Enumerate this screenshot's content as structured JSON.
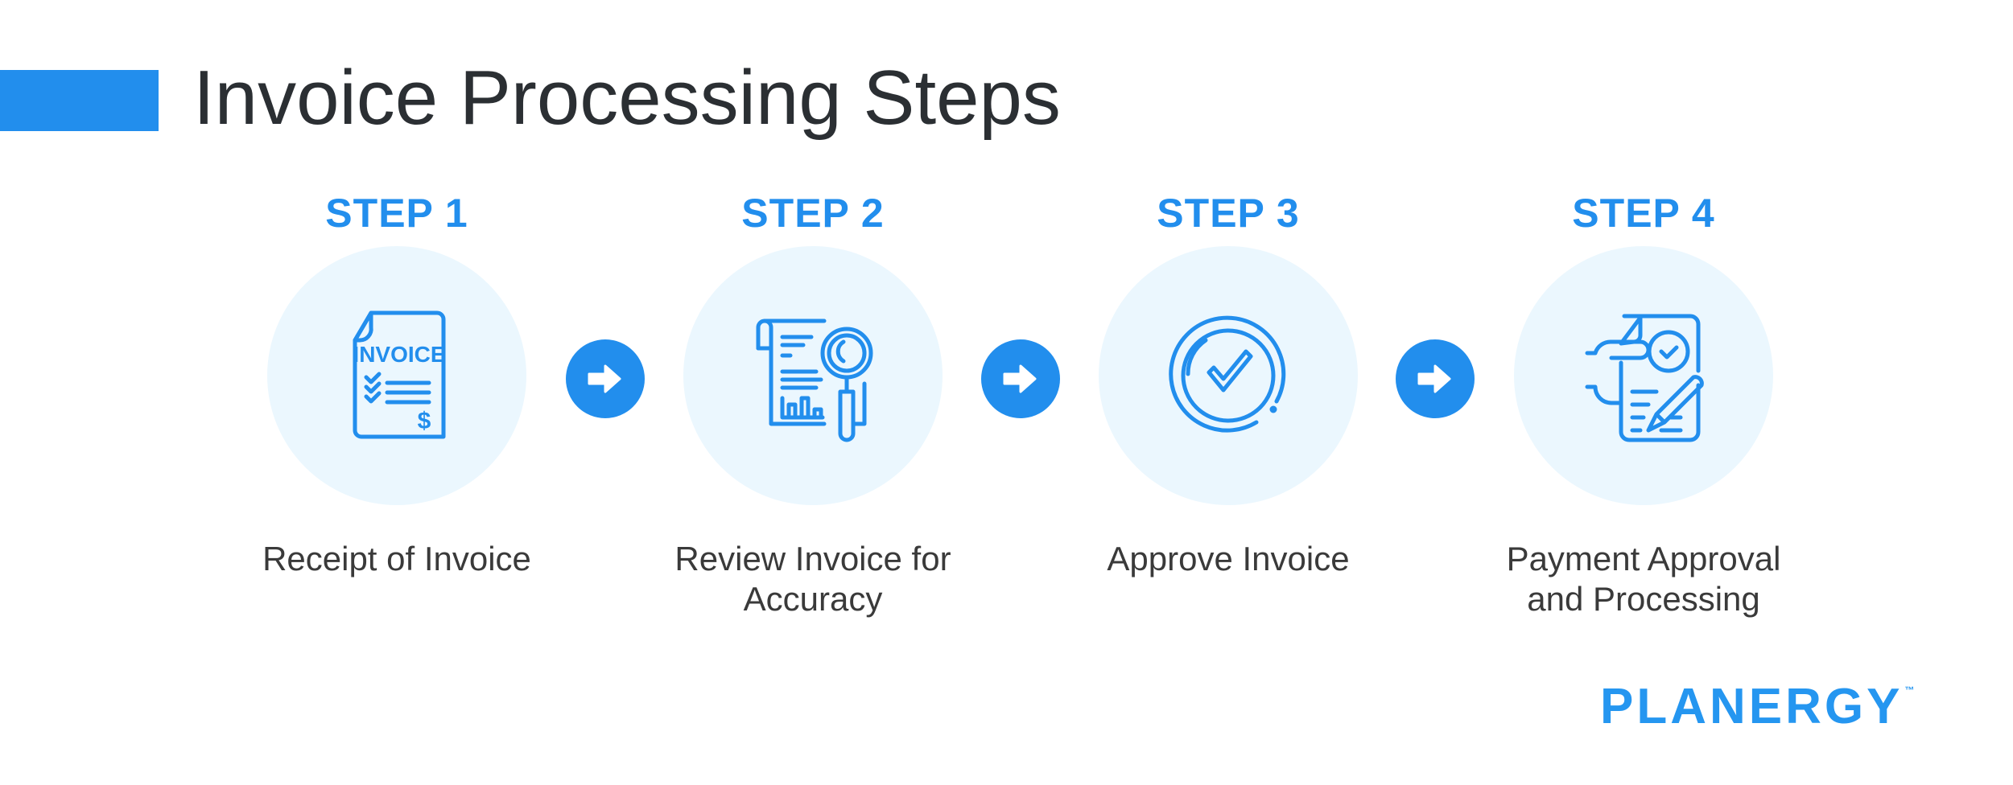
{
  "header": {
    "title": "Invoice Processing Steps",
    "accent_color": "#228eed"
  },
  "steps": [
    {
      "label": "STEP 1",
      "icon": "invoice-document-icon",
      "icon_text": "INVOICE",
      "icon_currency": "$",
      "caption": "Receipt of Invoice"
    },
    {
      "label": "STEP 2",
      "icon": "document-magnifier-icon",
      "caption": "Review Invoice for Accuracy"
    },
    {
      "label": "STEP 3",
      "icon": "check-circle-icon",
      "caption": "Approve Invoice"
    },
    {
      "label": "STEP 4",
      "icon": "signed-document-hand-icon",
      "caption": "Payment Approval and Processing"
    }
  ],
  "connectors": [
    {
      "icon": "arrow-right-icon"
    },
    {
      "icon": "arrow-right-icon"
    },
    {
      "icon": "arrow-right-icon"
    }
  ],
  "colors": {
    "primary_blue": "#228eed",
    "circle_background": "#ebf7fe",
    "title_text": "#2b2f33",
    "caption_text": "#3a3a3a",
    "logo_accent": "#ff5a12"
  },
  "brand": {
    "logo_text": "PLANERGY",
    "trademark": "™"
  }
}
